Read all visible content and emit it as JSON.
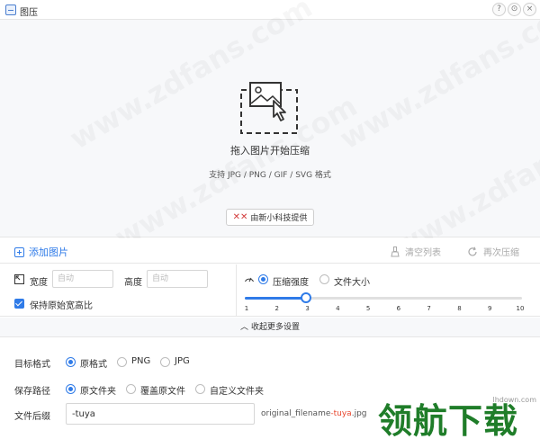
{
  "window": {
    "title": "图压",
    "controls": [
      "?",
      "⊙",
      "×"
    ]
  },
  "dropzone": {
    "title": "拖入图片开始压缩",
    "formats": "支持 JPG / PNG / GIF / SVG 格式",
    "provider": "由新小科技提供",
    "watermark": "www.zdfans.com"
  },
  "toolbar": {
    "add": "添加图片",
    "clear": "清空列表",
    "recompress": "再次压缩"
  },
  "size": {
    "width_label": "宽度",
    "width_placeholder": "自动",
    "height_label": "高度",
    "height_placeholder": "自动",
    "keep_ratio": "保持原始宽高比",
    "keep_ratio_checked": true
  },
  "compress": {
    "mode_strength": "压缩强度",
    "mode_filesize": "文件大小",
    "selected_mode": "压缩强度",
    "ticks": [
      "1",
      "2",
      "3",
      "4",
      "5",
      "6",
      "7",
      "8",
      "9",
      "10"
    ],
    "value": 3,
    "min": 1,
    "max": 10
  },
  "collapse": {
    "label": "收起更多设置"
  },
  "format": {
    "label": "目标格式",
    "options": [
      "原格式",
      "PNG",
      "JPG"
    ],
    "selected": "原格式"
  },
  "path": {
    "label": "保存路径",
    "options": [
      "原文件夹",
      "覆盖原文件",
      "自定义文件夹"
    ],
    "selected": "原文件夹"
  },
  "suffix": {
    "label": "文件后缀",
    "value": "-tuya",
    "preview_base": "original_filename",
    "preview_suffix": "-tuya",
    "preview_ext": ".jpg"
  },
  "site_logo": {
    "text": "领航下载",
    "url": "lhdown.com"
  },
  "colors": {
    "accent": "#2f7be8",
    "highlight": "#e8452c",
    "logo": "#1f7d29"
  }
}
